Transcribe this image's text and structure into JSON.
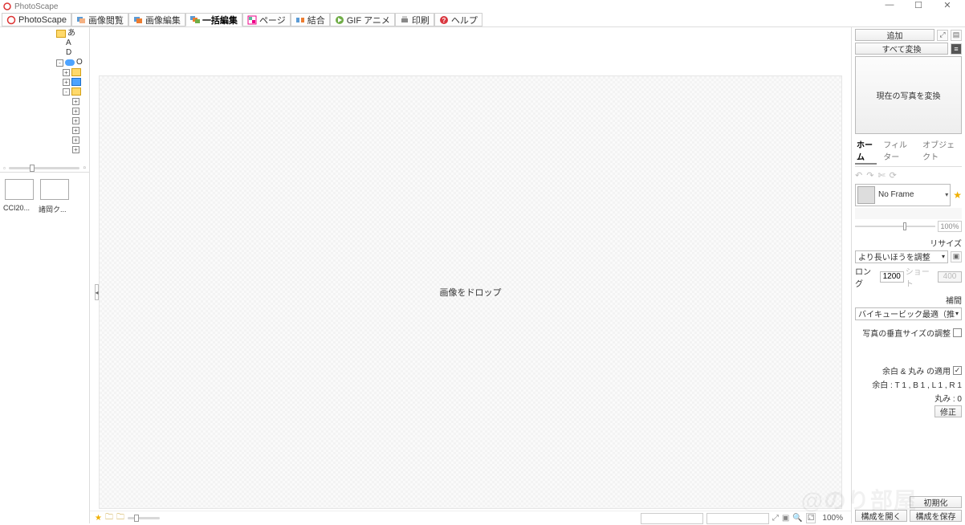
{
  "window": {
    "title": "PhotoScape"
  },
  "win_controls": {
    "min": "—",
    "max": "☐",
    "close": "✕"
  },
  "toolbar": {
    "tabs": [
      {
        "label": "PhotoScape"
      },
      {
        "label": "画像閲覧"
      },
      {
        "label": "画像編集"
      },
      {
        "label": "一括編集"
      },
      {
        "label": "ページ"
      },
      {
        "label": "結合"
      },
      {
        "label": "GIF アニメ"
      },
      {
        "label": "印刷"
      },
      {
        "label": "ヘルプ"
      }
    ],
    "active_index": 3
  },
  "tree": {
    "items": [
      {
        "indent": 70,
        "exp": null,
        "folderColor": "yellow",
        "label": "あ"
      },
      {
        "indent": 82,
        "exp": null,
        "folderColor": null,
        "label": "A"
      },
      {
        "indent": 82,
        "exp": null,
        "folderColor": null,
        "label": "D"
      },
      {
        "indent": 70,
        "exp": "-",
        "folderColor": "cloud",
        "label": "O"
      },
      {
        "indent": 78,
        "exp": "+",
        "folderColor": "yellow",
        "label": ""
      },
      {
        "indent": 78,
        "exp": "+",
        "folderColor": "blue",
        "label": ""
      },
      {
        "indent": 78,
        "exp": "-",
        "folderColor": "yellow",
        "label": ""
      },
      {
        "indent": 90,
        "exp": "+",
        "folderColor": null,
        "label": ""
      },
      {
        "indent": 90,
        "exp": "+",
        "folderColor": null,
        "label": ""
      },
      {
        "indent": 90,
        "exp": "+",
        "folderColor": null,
        "label": ""
      },
      {
        "indent": 90,
        "exp": "+",
        "folderColor": null,
        "label": ""
      },
      {
        "indent": 90,
        "exp": "+",
        "folderColor": null,
        "label": ""
      },
      {
        "indent": 90,
        "exp": "+",
        "folderColor": null,
        "label": ""
      }
    ]
  },
  "thumbnails": [
    {
      "label": "CCI20..."
    },
    {
      "label": "諸岡ク..."
    }
  ],
  "canvas": {
    "drop_text": "画像をドロップ"
  },
  "bottom": {
    "zoom_text": "100%"
  },
  "right": {
    "add_btn": "追加",
    "convert_all_btn": "すべて変換",
    "convert_current_btn": "現在の写真を変換",
    "tabs": [
      {
        "label": "ホーム"
      },
      {
        "label": "フィルター"
      },
      {
        "label": "オブジェクト"
      }
    ],
    "tabs_active": 0,
    "frame_select": "No Frame",
    "slider_pct": "100%",
    "resize_hdr": "リサイズ",
    "resize_mode": "より長いほうを調整",
    "long_label": "ロング",
    "long_value": "1200",
    "short_label": "ショート",
    "short_value": "400",
    "interp_hdr": "補間",
    "interp_mode": "バイキュービック最適（推",
    "vertical_adjust_label": "写真の垂直サイズの調整",
    "vertical_adjust_checked": false,
    "margin_apply_label": "余白 & 丸み の適用",
    "margin_apply_checked": true,
    "margin_values": "余白 : T 1 , B 1 , L 1 , R 1",
    "round_values": "丸み : 0",
    "modify_btn": "修正",
    "reset_btn": "初期化",
    "open_config_btn": "構成を開く",
    "save_config_btn": "構成を保存"
  },
  "watermark": "@のり部屋"
}
